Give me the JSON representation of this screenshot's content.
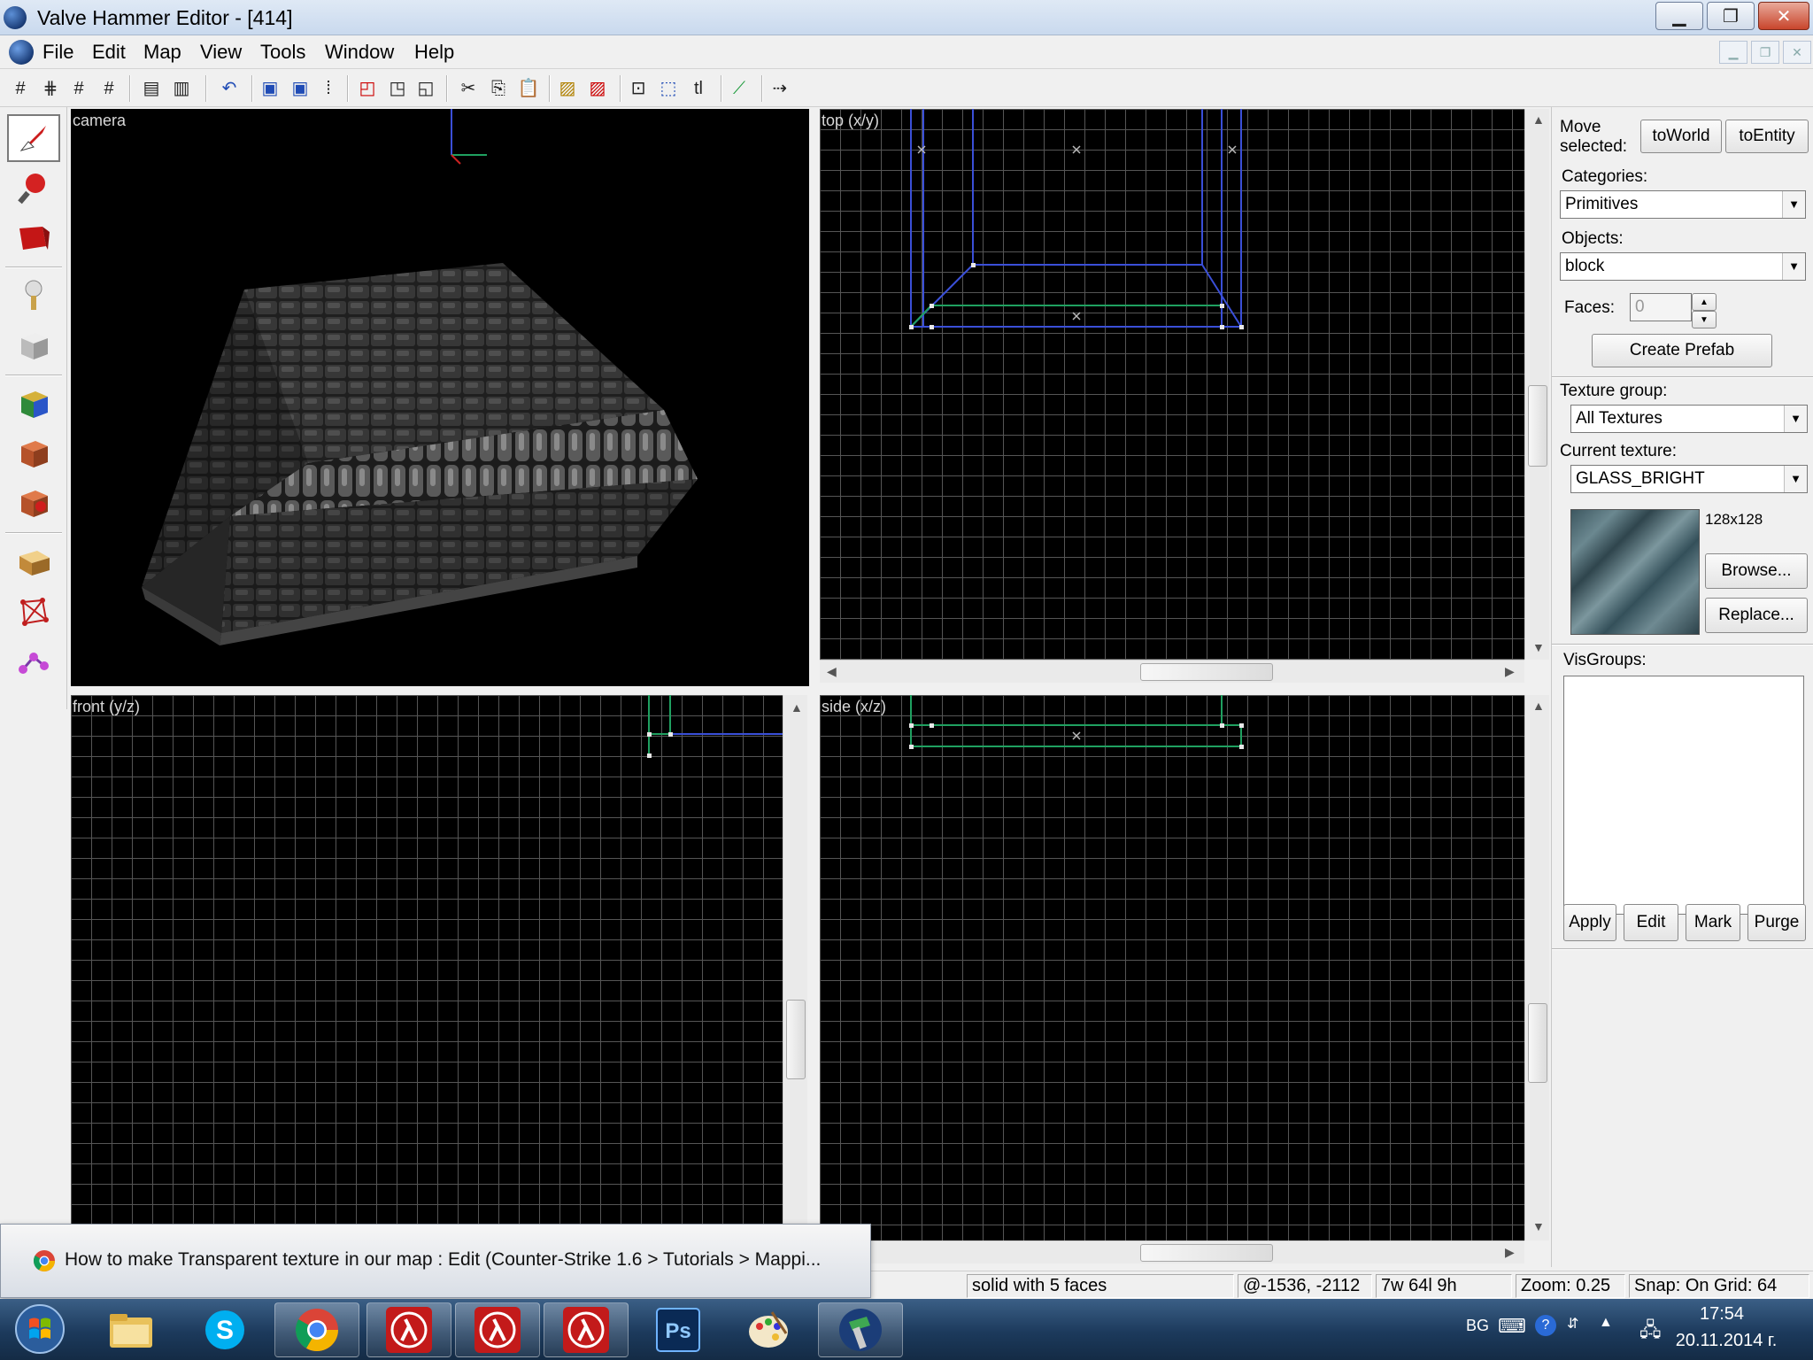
{
  "window": {
    "title": "Valve Hammer Editor - [414]",
    "minimize_glyph": "▁",
    "maximize_glyph": "❐",
    "close_glyph": "✕"
  },
  "menu": {
    "items": [
      {
        "label": "File"
      },
      {
        "label": "Edit"
      },
      {
        "label": "Map"
      },
      {
        "label": "View"
      },
      {
        "label": "Tools"
      },
      {
        "label": "Window"
      },
      {
        "label": "Help"
      }
    ]
  },
  "viewports": {
    "camera": {
      "label": "camera"
    },
    "top": {
      "label": "top (x/y)"
    },
    "front": {
      "label": "front (y/z)"
    },
    "side": {
      "label": "side (x/z)"
    }
  },
  "right_panel": {
    "move_selected_label": "Move selected:",
    "to_world_label": "toWorld",
    "to_entity_label": "toEntity",
    "categories_label": "Categories:",
    "categories_value": "Primitives",
    "objects_label": "Objects:",
    "objects_value": "block",
    "faces_label": "Faces:",
    "faces_value": "0",
    "create_prefab_label": "Create Prefab",
    "texture_group_label": "Texture group:",
    "texture_group_value": "All Textures",
    "current_texture_label": "Current texture:",
    "current_texture_value": "GLASS_BRIGHT",
    "texture_size": "128x128",
    "browse_label": "Browse...",
    "replace_label": "Replace...",
    "visgroups_label": "VisGroups:",
    "apply_label": "Apply",
    "edit_label": "Edit",
    "mark_label": "Mark",
    "purge_label": "Purge"
  },
  "status_bar": {
    "selection": "solid with 5 faces",
    "coords": "@-1536, -2112",
    "size": "7w 64l 9h",
    "zoom": "Zoom: 0.25",
    "snap": "Snap: On Grid: 64"
  },
  "notification": {
    "text": "How to make Transparent texture in our map : Edit (Counter-Strike 1.6 > Tutorials > Mappi..."
  },
  "taskbar": {
    "lang": "BG",
    "time": "17:54",
    "date": "20.11.2014 г.",
    "apps": [
      {
        "name": "start-button"
      },
      {
        "name": "explorer"
      },
      {
        "name": "skype"
      },
      {
        "name": "chrome"
      },
      {
        "name": "half-life-1"
      },
      {
        "name": "half-life-2"
      },
      {
        "name": "half-life-3"
      },
      {
        "name": "photoshop"
      },
      {
        "name": "paint"
      },
      {
        "name": "hammer"
      }
    ]
  },
  "colors": {
    "viewport_bg": "#000000",
    "grid": "#555555",
    "brush_blue": "#3a4fd8",
    "brush_green": "#1fa060",
    "selection_white": "#e8e8e8",
    "taskbar": "#1c3a5c"
  }
}
